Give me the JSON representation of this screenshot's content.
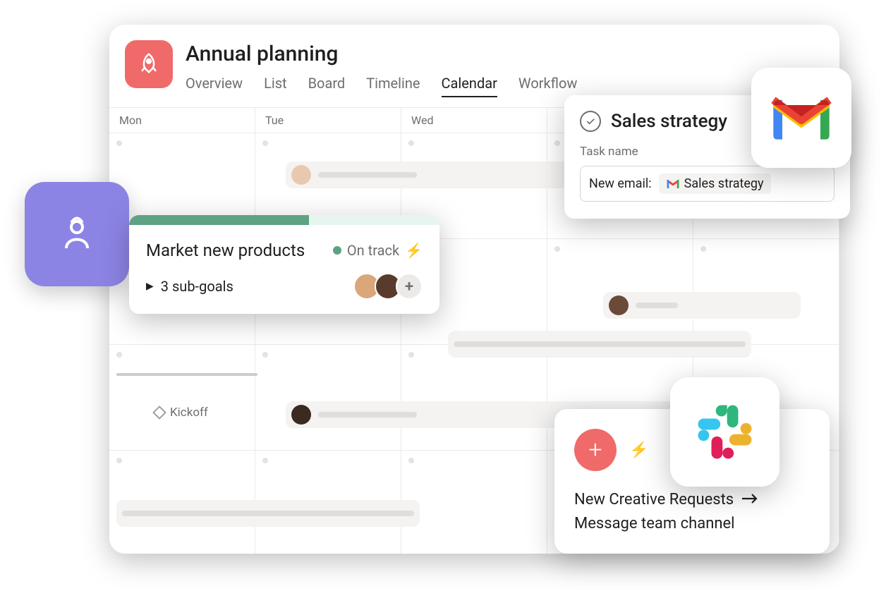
{
  "project": {
    "title": "Annual planning",
    "tabs": [
      "Overview",
      "List",
      "Board",
      "Timeline",
      "Calendar",
      "Workflow"
    ],
    "active_tab": "Calendar"
  },
  "calendar": {
    "days": [
      "Mon",
      "Tue",
      "Wed"
    ],
    "milestone": "Kickoff"
  },
  "goal": {
    "title": "Market new products",
    "status": "On track",
    "subgoals": "3 sub-goals",
    "progress_pct": 58
  },
  "task_panel": {
    "title": "Sales strategy",
    "field_label": "Task name",
    "input_prefix": "New email:",
    "input_pill": "Sales strategy"
  },
  "slack_card": {
    "line1": "New Creative Requests",
    "line2": "Message team channel"
  }
}
